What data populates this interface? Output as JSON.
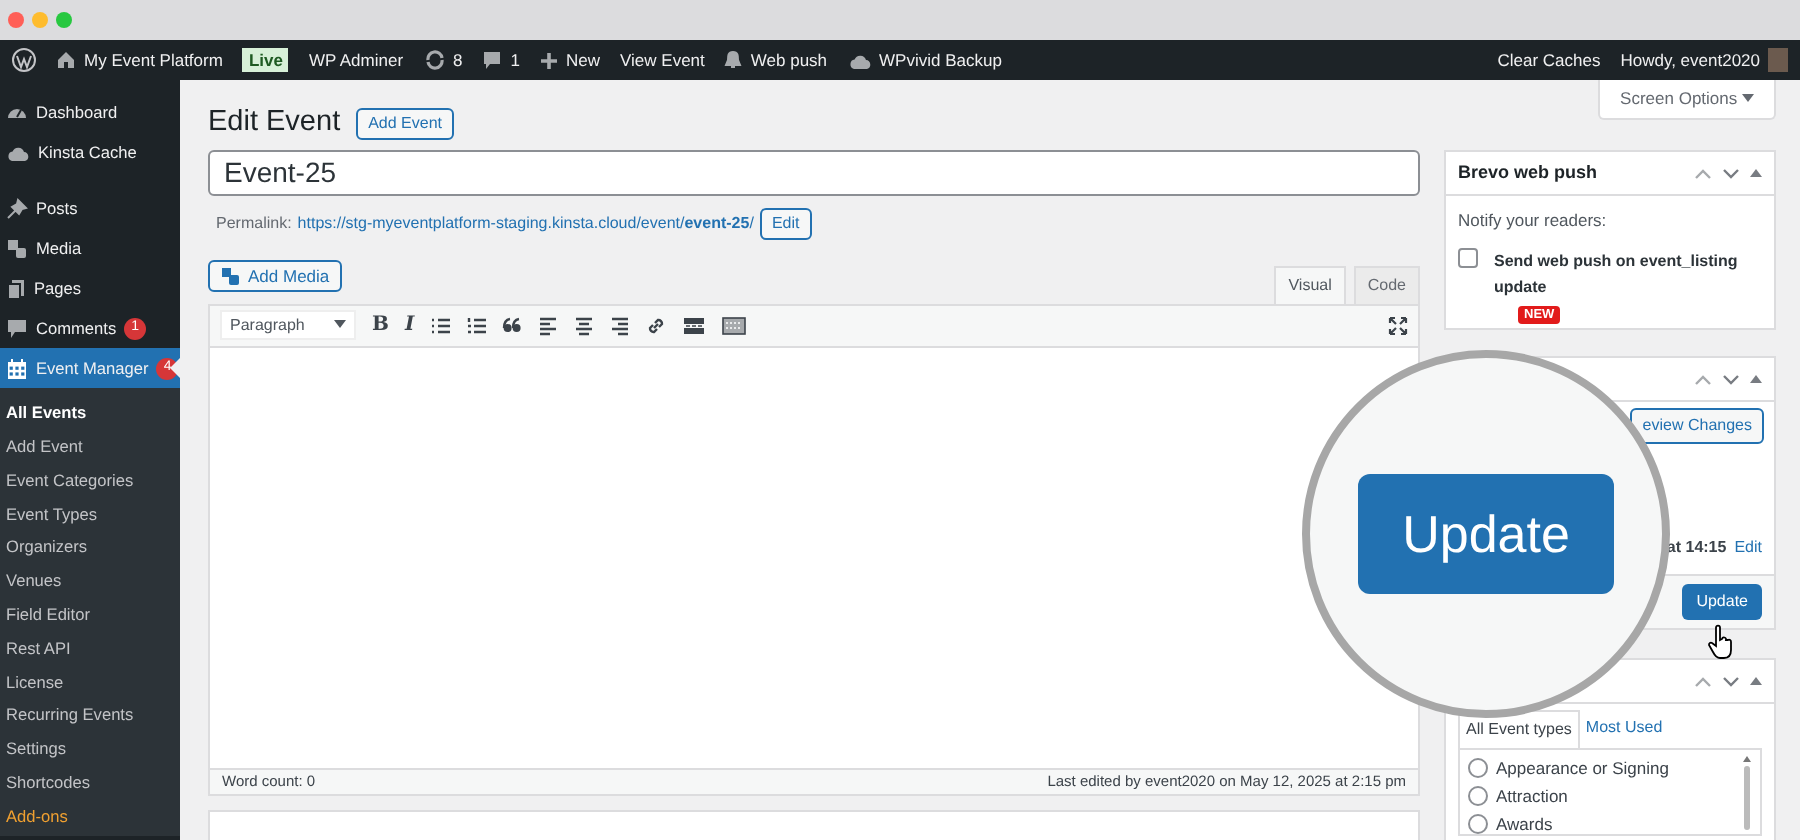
{
  "admin_bar": {
    "items": [
      {
        "kind": "logo"
      },
      {
        "kind": "site",
        "label": "My Event Platform"
      },
      {
        "kind": "badge",
        "label": "Live"
      },
      {
        "kind": "link",
        "label": "WP Adminer"
      },
      {
        "kind": "updates",
        "label": "8"
      },
      {
        "kind": "comments",
        "label": "1"
      },
      {
        "kind": "new",
        "label": "New"
      },
      {
        "kind": "link",
        "label": "View Event"
      },
      {
        "kind": "push",
        "label": "Web push"
      },
      {
        "kind": "backup",
        "label": "WPvivid Backup"
      }
    ],
    "right": [
      {
        "kind": "link",
        "label": "Clear Caches"
      },
      {
        "kind": "account",
        "label": "Howdy, event2020"
      }
    ]
  },
  "sidebar": {
    "groups": [
      [
        {
          "kind": "dashboard",
          "label": "Dashboard",
          "selected": false
        },
        {
          "kind": "cloud",
          "label": "Kinsta Cache",
          "selected": false
        }
      ],
      [
        {
          "kind": "pin",
          "label": "Posts",
          "selected": false
        },
        {
          "kind": "media",
          "label": "Media",
          "selected": false
        },
        {
          "kind": "pages",
          "label": "Pages",
          "selected": false
        },
        {
          "kind": "comments",
          "label": "Comments",
          "count": "1",
          "selected": false
        },
        {
          "kind": "calendar",
          "label": "Event Manager",
          "count": "4",
          "selected": true
        }
      ]
    ],
    "submenu": [
      {
        "kind": "link",
        "label": "All Events",
        "selected": true
      },
      {
        "kind": "link",
        "label": "Add Event",
        "selected": false
      },
      {
        "kind": "link",
        "label": "Event Categories",
        "selected": false
      },
      {
        "kind": "link",
        "label": "Event Types",
        "selected": false
      },
      {
        "kind": "link",
        "label": "Organizers",
        "selected": false
      },
      {
        "kind": "link",
        "label": "Venues",
        "selected": false
      },
      {
        "kind": "link",
        "label": "Field Editor",
        "selected": false
      },
      {
        "kind": "link",
        "label": "Rest API",
        "selected": false
      },
      {
        "kind": "link",
        "label": "License",
        "selected": false
      },
      {
        "kind": "link",
        "label": "Recurring Events",
        "selected": false
      },
      {
        "kind": "link",
        "label": "Settings",
        "selected": false
      },
      {
        "kind": "link",
        "label": "Shortcodes",
        "selected": false
      },
      {
        "kind": "addon",
        "label": "Add-ons",
        "selected": false
      }
    ]
  },
  "screen_options": "Screen Options",
  "editor": {
    "title": "Edit Event",
    "add_button": "Add Event",
    "title_value": "Event-25",
    "permalink": {
      "label": "Permalink:",
      "url": "https://stg-myeventplatform-staging.kinsta.cloud/event/**event-25**/",
      "edit_button": "Edit"
    },
    "add_media": "Add Media",
    "tabs": [
      {
        "label": "Visual",
        "selected": true
      },
      {
        "label": "Code",
        "selected": false
      }
    ],
    "toolbar": {
      "format": "Paragraph",
      "text_buttons": [
        "B",
        "I"
      ]
    },
    "status": {
      "word_count": "Word count: 0",
      "last_edited": "Last edited by event2020 on May 12, 2025 at 2:15 pm"
    }
  },
  "brevo": {
    "title": "Brevo web push",
    "intro": "Notify your readers:",
    "option": {
      "label": "Send web push on event_listing update",
      "checked": false
    },
    "badge": "NEW"
  },
  "publish": {
    "preview_button": "eview Changes",
    "schedule": "at 14:15",
    "edit_link": "Edit",
    "update_button": "Update"
  },
  "magnifier": {
    "button": "Update"
  },
  "event_types": {
    "tabs": [
      {
        "label": "All Event types",
        "selected": true
      },
      {
        "label": "Most Used",
        "selected": false
      }
    ],
    "items": [
      {
        "label": "Appearance or Signing",
        "checked": false
      },
      {
        "label": "Attraction",
        "checked": false
      },
      {
        "label": "Awards",
        "checked": false
      }
    ]
  }
}
